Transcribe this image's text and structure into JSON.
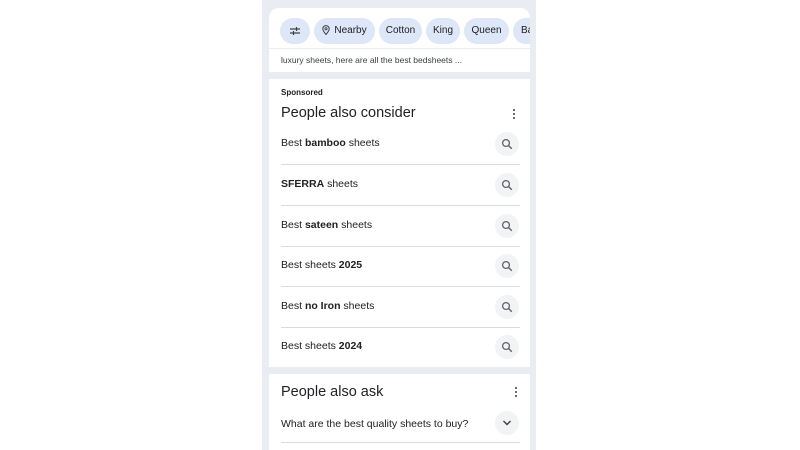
{
  "chips": [
    {
      "icon": "filter-sliders-icon",
      "label": ""
    },
    {
      "icon": "location-pin-icon",
      "label": "Nearby"
    },
    {
      "icon": "",
      "label": "Cotton"
    },
    {
      "icon": "",
      "label": "King"
    },
    {
      "icon": "",
      "label": "Queen"
    },
    {
      "icon": "",
      "label": "Ba"
    }
  ],
  "snippet": "luxury sheets, here are all the best bedsheets ...",
  "consider": {
    "sponsored_label": "Sponsored",
    "title": "People also consider",
    "items": [
      {
        "pre": "Best ",
        "bold": "bamboo",
        "post": " sheets"
      },
      {
        "pre": "",
        "bold": "SFERRA",
        "post": " sheets"
      },
      {
        "pre": "Best ",
        "bold": "sateen",
        "post": " sheets"
      },
      {
        "pre": "Best sheets ",
        "bold": "2025",
        "post": ""
      },
      {
        "pre": "Best ",
        "bold": "no Iron",
        "post": " sheets"
      },
      {
        "pre": "Best sheets ",
        "bold": "2024",
        "post": ""
      }
    ]
  },
  "ask": {
    "title": "People also ask",
    "questions": [
      "What are the best quality sheets to buy?"
    ]
  },
  "colors": {
    "page_bg": "#e9edf3",
    "chip_bg": "#dde7f7",
    "button_bg": "#f1f3f4",
    "divider": "#dadce0"
  }
}
